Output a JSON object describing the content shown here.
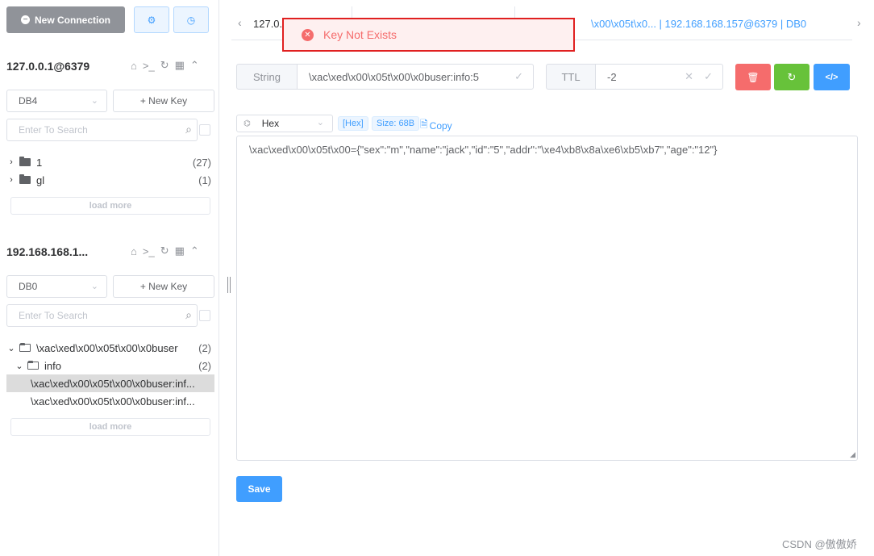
{
  "toolbar": {
    "new_connection_label": "New Connection",
    "settings_icon": "settings-icon",
    "history_icon": "clock-icon"
  },
  "connections": [
    {
      "name": "127.0.0.1@6379",
      "db": "DB4",
      "new_key_label": "+ New Key",
      "search_placeholder": "Enter To Search",
      "tree": [
        {
          "label": "1",
          "count": "(27)"
        },
        {
          "label": "gl",
          "count": "(1)"
        }
      ],
      "load_more": "load more"
    },
    {
      "name": "192.168.168.1...",
      "db": "DB0",
      "new_key_label": "+ New Key",
      "search_placeholder": "Enter To Search",
      "tree": [
        {
          "label": "\\xac\\xed\\x00\\x05t\\x00\\x0buser",
          "count": "(2)"
        },
        {
          "label": "info",
          "count": "(2)"
        },
        {
          "label": "\\xac\\xed\\x00\\x05t\\x00\\x0buser:inf..."
        },
        {
          "label": "\\xac\\xed\\x00\\x05t\\x00\\x0buser:inf..."
        }
      ],
      "load_more": "load more"
    }
  ],
  "tabs": {
    "first": "127.0.",
    "active": "\\x00\\x05t\\x0... | 192.168.168.157@6379 | DB0"
  },
  "toast": {
    "message": "Key Not Exists",
    "color": "#f56c6c"
  },
  "key_bar": {
    "type_label": "String",
    "key_value": "\\xac\\xed\\x00\\x05t\\x00\\x0buser:info:5",
    "ttl_label": "TTL",
    "ttl_value": "-2"
  },
  "viewer": {
    "format": "Hex",
    "hex_tag": "[Hex]",
    "size_tag": "Size: 68B",
    "copy_label": "Copy",
    "content": "\\xac\\xed\\x00\\x05t\\x00={\"sex\":\"m\",\"name\":\"jack\",\"id\":\"5\",\"addr\":\"\\xe4\\xb8\\x8a\\xe6\\xb5\\xb7\",\"age\":\"12\"}",
    "save_label": "Save"
  },
  "colors": {
    "primary": "#409eff",
    "danger": "#f56c6c",
    "success": "#67c23a"
  },
  "watermark": "CSDN @傲傲娇"
}
